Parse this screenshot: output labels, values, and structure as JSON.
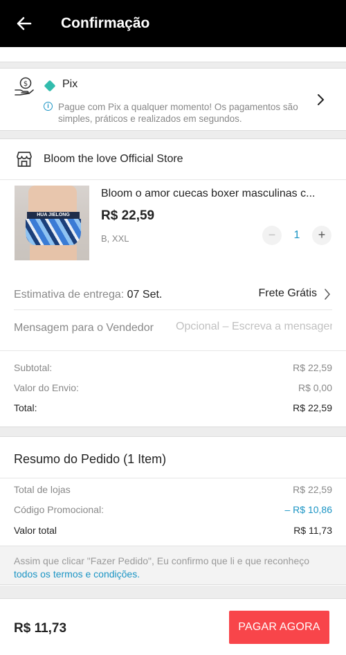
{
  "header": {
    "title": "Confirmação",
    "back_icon": "arrow-left-icon"
  },
  "payment": {
    "method": "Pix",
    "description": "Pague com Pix a qualquer momento! Os pagamentos são simples, práticos e realizados em segundos.",
    "brand_color": "#32bcad"
  },
  "store": {
    "name": "Bloom the love Official Store",
    "product": {
      "title": "Bloom o amor cuecas boxer masculinas c...",
      "image_text": "HUA JIELONG",
      "price": "R$ 22,59",
      "variant": "B, XXL",
      "quantity": "1",
      "minus": "−",
      "plus": "+"
    },
    "delivery": {
      "label": "Estimativa de entrega:",
      "date": "07 Set.",
      "shipping": "Frete Grátis"
    },
    "message": {
      "label": "Mensagem para o Vendedor",
      "placeholder": "Opcional – Escreva a mensagem"
    },
    "totals": {
      "subtotal_label": "Subtotal:",
      "subtotal_value": "R$ 22,59",
      "shipping_label": "Valor do Envio:",
      "shipping_value": "R$ 0,00",
      "total_label": "Total:",
      "total_value": "R$ 22,59"
    }
  },
  "summary": {
    "title": "Resumo do Pedido (1 Item)",
    "stores_label": "Total de lojas",
    "stores_value": "R$ 22,59",
    "promo_label": "Código Promocional:",
    "promo_value": "– R$ 10,86",
    "total_label": "Valor total",
    "total_value": "R$ 11,73",
    "terms_text": "Assim que clicar \"Fazer Pedido\", Eu confirmo que li e que reconheço ",
    "terms_link": "todos os termos e condições."
  },
  "bottom": {
    "total": "R$ 11,73",
    "pay_label": "PAGAR AGORA"
  },
  "colors": {
    "accent": "#1a94c4",
    "pay_button": "#f8454a",
    "header": "#000000"
  }
}
